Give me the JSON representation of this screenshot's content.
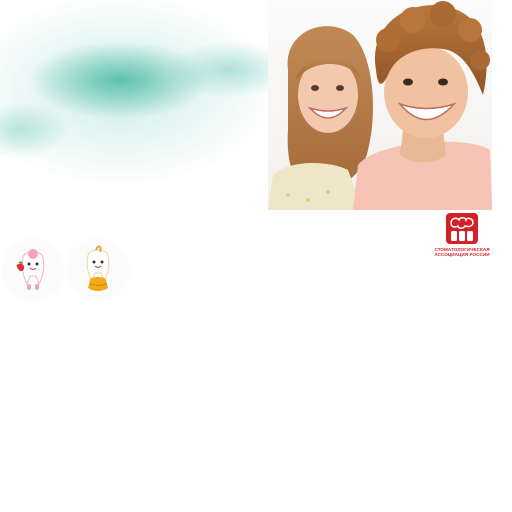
{
  "hero": {
    "photo_icon": "smiling-children-photo",
    "splash_color": "#4bb9a5"
  },
  "mascots": [
    {
      "icon": "tooth-with-strawberry-icon"
    },
    {
      "icon": "tooth-with-honey-icon"
    }
  ],
  "logo": {
    "icon": "dental-association-logo-icon",
    "color": "#d42027",
    "line1": "СТОМАТОЛОГИЧЕСКАЯ",
    "line2": "АССОЦИАЦИЯ РОССИИ"
  }
}
